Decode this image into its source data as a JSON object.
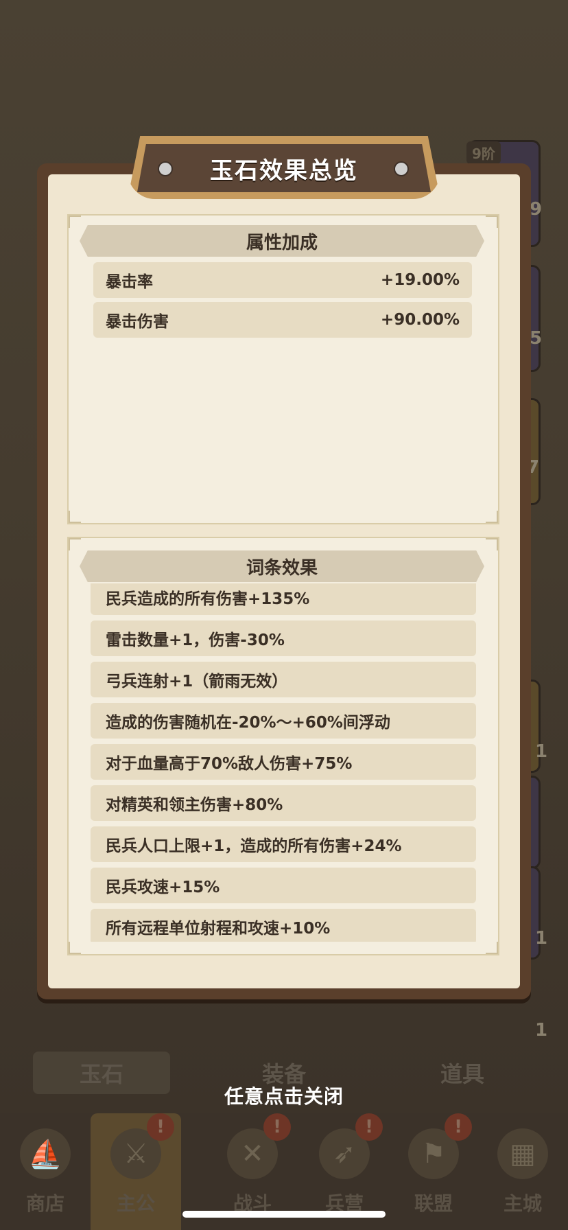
{
  "modal": {
    "title": "玉石效果总览",
    "attributes_header": "属性加成",
    "attributes": [
      {
        "label": "暴击率",
        "value": "+19.00%"
      },
      {
        "label": "暴击伤害",
        "value": "+90.00%"
      }
    ],
    "effects_header": "词条效果",
    "effects": [
      "民兵造成的所有伤害+135%",
      "雷击数量+1，伤害-30%",
      "弓兵连射+1（箭雨无效）",
      "造成的伤害随机在-20%～+60%间浮动",
      "对于血量高于70%敌人伤害+75%",
      "对精英和领主伤害+80%",
      "民兵人口上限+1，造成的所有伤害+24%",
      "民兵攻速+15%",
      "所有远程单位射程和攻速+10%"
    ]
  },
  "close_hint": "任意点击关闭",
  "background": {
    "tabs": [
      "玉石",
      "装备",
      "道具"
    ],
    "badge_label": "9阶",
    "side_counts": [
      "9",
      "5",
      "7",
      "1",
      "1",
      "1"
    ],
    "nav": [
      {
        "label": "商店",
        "badge": "!"
      },
      {
        "label": "主公",
        "badge": "!"
      },
      {
        "label": "战斗",
        "badge": "!"
      },
      {
        "label": "兵营",
        "badge": "!"
      },
      {
        "label": "联盟",
        "badge": "!"
      },
      {
        "label": "主城",
        "badge": ""
      }
    ]
  }
}
